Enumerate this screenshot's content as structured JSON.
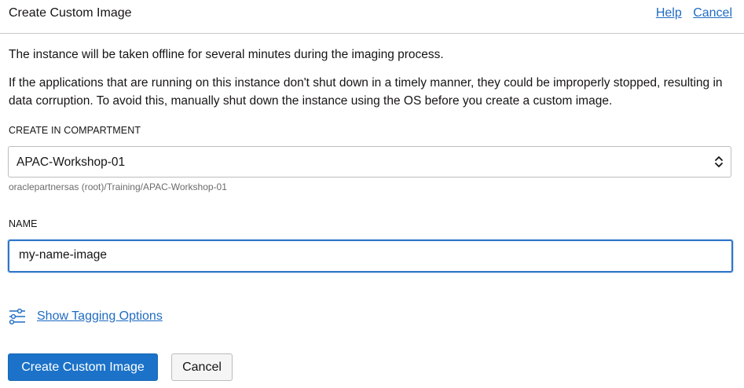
{
  "dialog": {
    "title": "Create Custom Image",
    "help_link": "Help",
    "cancel_link": "Cancel"
  },
  "body": {
    "paragraph_1": "The instance will be taken offline for several minutes during the imaging process.",
    "paragraph_2": "If the applications that are running on this instance don't shut down in a timely manner, they could be improperly stopped, resulting in data corruption. To avoid this, manually shut down the instance using the OS before you create a custom image."
  },
  "compartment": {
    "label": "CREATE IN COMPARTMENT",
    "selected_value": "APAC-Workshop-01",
    "path": "oraclepartnersas (root)/Training/APAC-Workshop-01",
    "icon": "select-updown-icon"
  },
  "name": {
    "label": "NAME",
    "value": "my-name-image"
  },
  "tagging": {
    "icon": "sliders-icon",
    "link_label": "Show Tagging Options"
  },
  "buttons": {
    "create_label": "Create Custom Image",
    "cancel_label": "Cancel"
  },
  "colors": {
    "link": "#1f6cc2",
    "primary_button": "#1b72c8",
    "focus_border": "#2f76c8"
  }
}
